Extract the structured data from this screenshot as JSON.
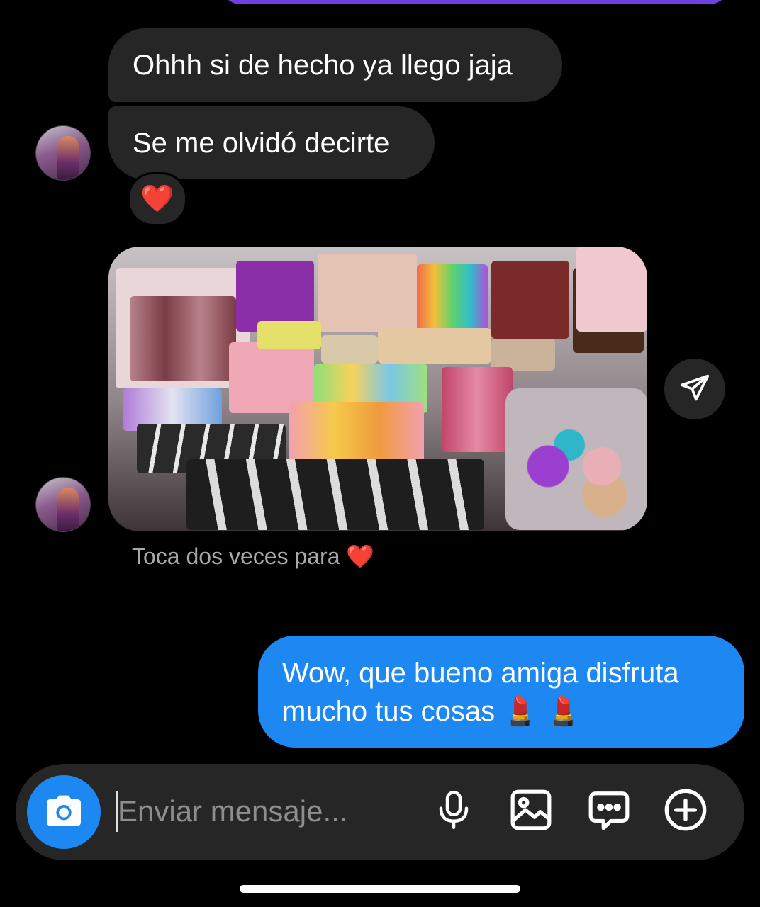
{
  "conversation": {
    "incoming": [
      {
        "text": "Ohhh si de hecho ya llego jaja"
      },
      {
        "text": "Se me olvidó decirte",
        "reaction": "❤️"
      }
    ],
    "photo_hint": "Toca dos veces para ❤️",
    "outgoing": [
      {
        "text": "Wow, que bueno amiga disfruta mucho tus cosas 💄 💄"
      }
    ]
  },
  "composer": {
    "placeholder": "Enviar mensaje..."
  },
  "icons": {
    "camera": "camera-icon",
    "mic": "microphone-icon",
    "gallery": "image-gallery-icon",
    "sticker": "chat-bubble-ellipsis-icon",
    "plus": "plus-circle-icon",
    "share": "paper-plane-icon"
  },
  "colors": {
    "background": "#000000",
    "incoming_bubble": "#262626",
    "outgoing_bubble": "#1d88f2",
    "accent_purple": "#6f3fe0"
  }
}
